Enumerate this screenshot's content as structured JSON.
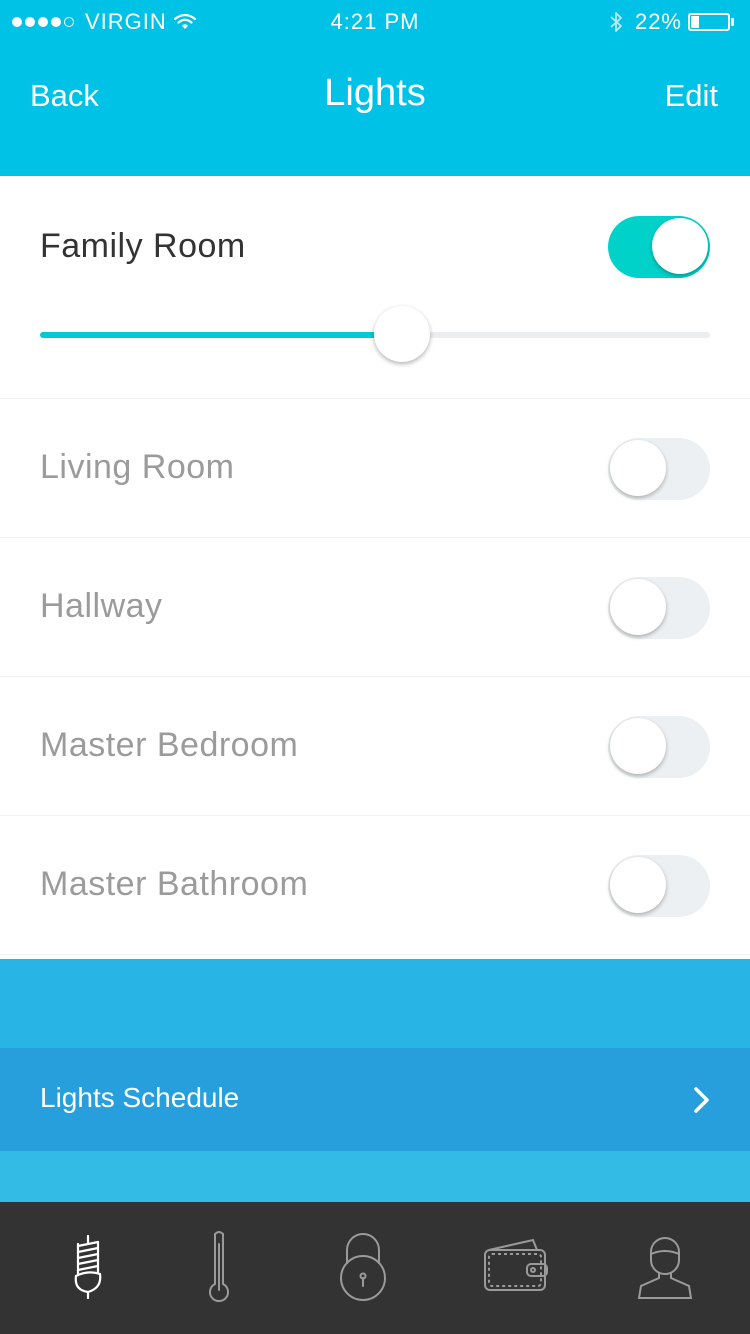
{
  "status_bar": {
    "carrier": "VIRGIN",
    "time": "4:21 PM",
    "battery_percent": "22%",
    "battery_level": 0.22,
    "signal_bars_filled": 4,
    "signal_bars_total": 5
  },
  "nav": {
    "back_label": "Back",
    "title": "Lights",
    "edit_label": "Edit"
  },
  "rooms": [
    {
      "name": "Family Room",
      "on": true,
      "brightness": 0.54
    },
    {
      "name": "Living Room",
      "on": false
    },
    {
      "name": "Hallway",
      "on": false
    },
    {
      "name": "Master Bedroom",
      "on": false
    },
    {
      "name": "Master Bathroom",
      "on": false
    }
  ],
  "schedule": {
    "label": "Lights Schedule",
    "icon": "chevron-right-icon"
  },
  "tabs": [
    {
      "icon": "lightbulb-icon",
      "active": true
    },
    {
      "icon": "thermometer-icon",
      "active": false
    },
    {
      "icon": "lock-icon",
      "active": false
    },
    {
      "icon": "wallet-icon",
      "active": false
    },
    {
      "icon": "user-icon",
      "active": false
    }
  ],
  "colors": {
    "header": "#00c2e6",
    "toggle_on": "#00d2c9",
    "slider": "#00cbd4",
    "schedule_row": "#289fdd",
    "band": "#2eb7e5",
    "tabbar": "#333333"
  }
}
